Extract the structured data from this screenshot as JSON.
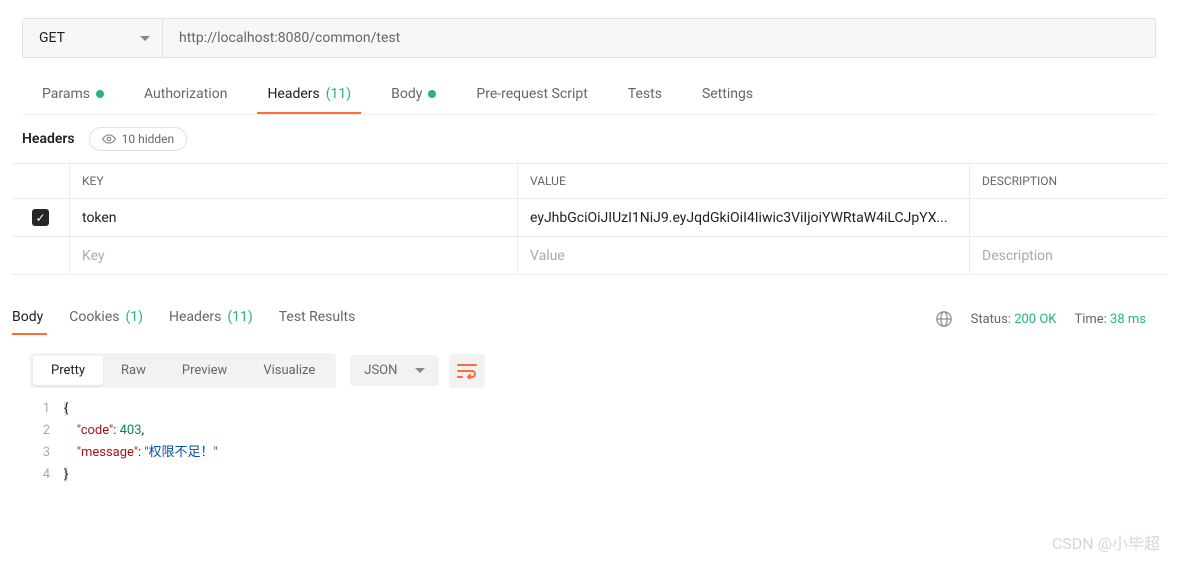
{
  "request": {
    "method": "GET",
    "url": "http://localhost:8080/common/test"
  },
  "reqTabs": {
    "params": "Params",
    "auth": "Authorization",
    "headers": "Headers",
    "headersCount": "(11)",
    "body": "Body",
    "prereq": "Pre-request Script",
    "tests": "Tests",
    "settings": "Settings"
  },
  "headersSub": {
    "label": "Headers",
    "hidden": "10 hidden"
  },
  "table": {
    "head": {
      "key": "KEY",
      "value": "VALUE",
      "desc": "DESCRIPTION"
    },
    "rows": [
      {
        "key": "token",
        "value": "eyJhbGciOiJIUzI1NiJ9.eyJqdGkiOiI4Iiwic3ViIjoiYWRtaW4iLCJpYX..."
      }
    ],
    "placeholders": {
      "key": "Key",
      "value": "Value",
      "desc": "Description"
    }
  },
  "respTabs": {
    "body": "Body",
    "cookies": "Cookies",
    "cookiesCount": "(1)",
    "headers": "Headers",
    "headersCount": "(11)",
    "tests": "Test Results"
  },
  "status": {
    "statusLbl": "Status:",
    "statusVal": "200 OK",
    "timeLbl": "Time:",
    "timeVal": "38 ms"
  },
  "modes": {
    "pretty": "Pretty",
    "raw": "Raw",
    "preview": "Preview",
    "visualize": "Visualize",
    "format": "JSON"
  },
  "json": {
    "l1": "{",
    "l2": {
      "indent": "    ",
      "key": "\"code\"",
      "colon": ": ",
      "val": "403",
      "comma": ","
    },
    "l3": {
      "indent": "    ",
      "key": "\"message\"",
      "colon": ": ",
      "val": "\"权限不足！\""
    },
    "l4": "}",
    "n1": "1",
    "n2": "2",
    "n3": "3",
    "n4": "4"
  },
  "watermark": "CSDN @小毕超"
}
